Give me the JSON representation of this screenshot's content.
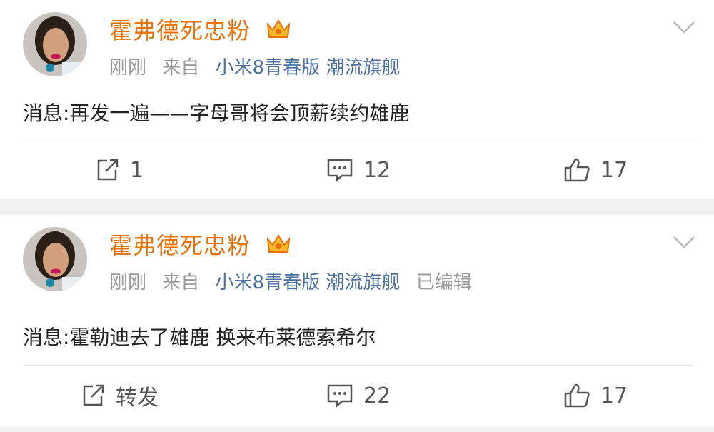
{
  "colors": {
    "username": "#e8710a",
    "source_link": "#4d6fa0",
    "meta": "#9a9a9a",
    "text": "#222222",
    "icon": "#555555"
  },
  "posts": [
    {
      "username": "霍弗德死忠粉",
      "time": "刚刚",
      "from_label": "来自",
      "source": "小米8青春版 潮流旗舰",
      "edited": "",
      "text": "消息:再发一遍——字母哥将会顶薪续约雄鹿",
      "repost_label": "1",
      "comment_count": "12",
      "like_count": "17"
    },
    {
      "username": "霍弗德死忠粉",
      "time": "刚刚",
      "from_label": "来自",
      "source": "小米8青春版 潮流旗舰",
      "edited": "已编辑",
      "text": "消息:霍勒迪去了雄鹿 换来布莱德索希尔",
      "repost_label": "转发",
      "comment_count": "22",
      "like_count": "17"
    }
  ]
}
